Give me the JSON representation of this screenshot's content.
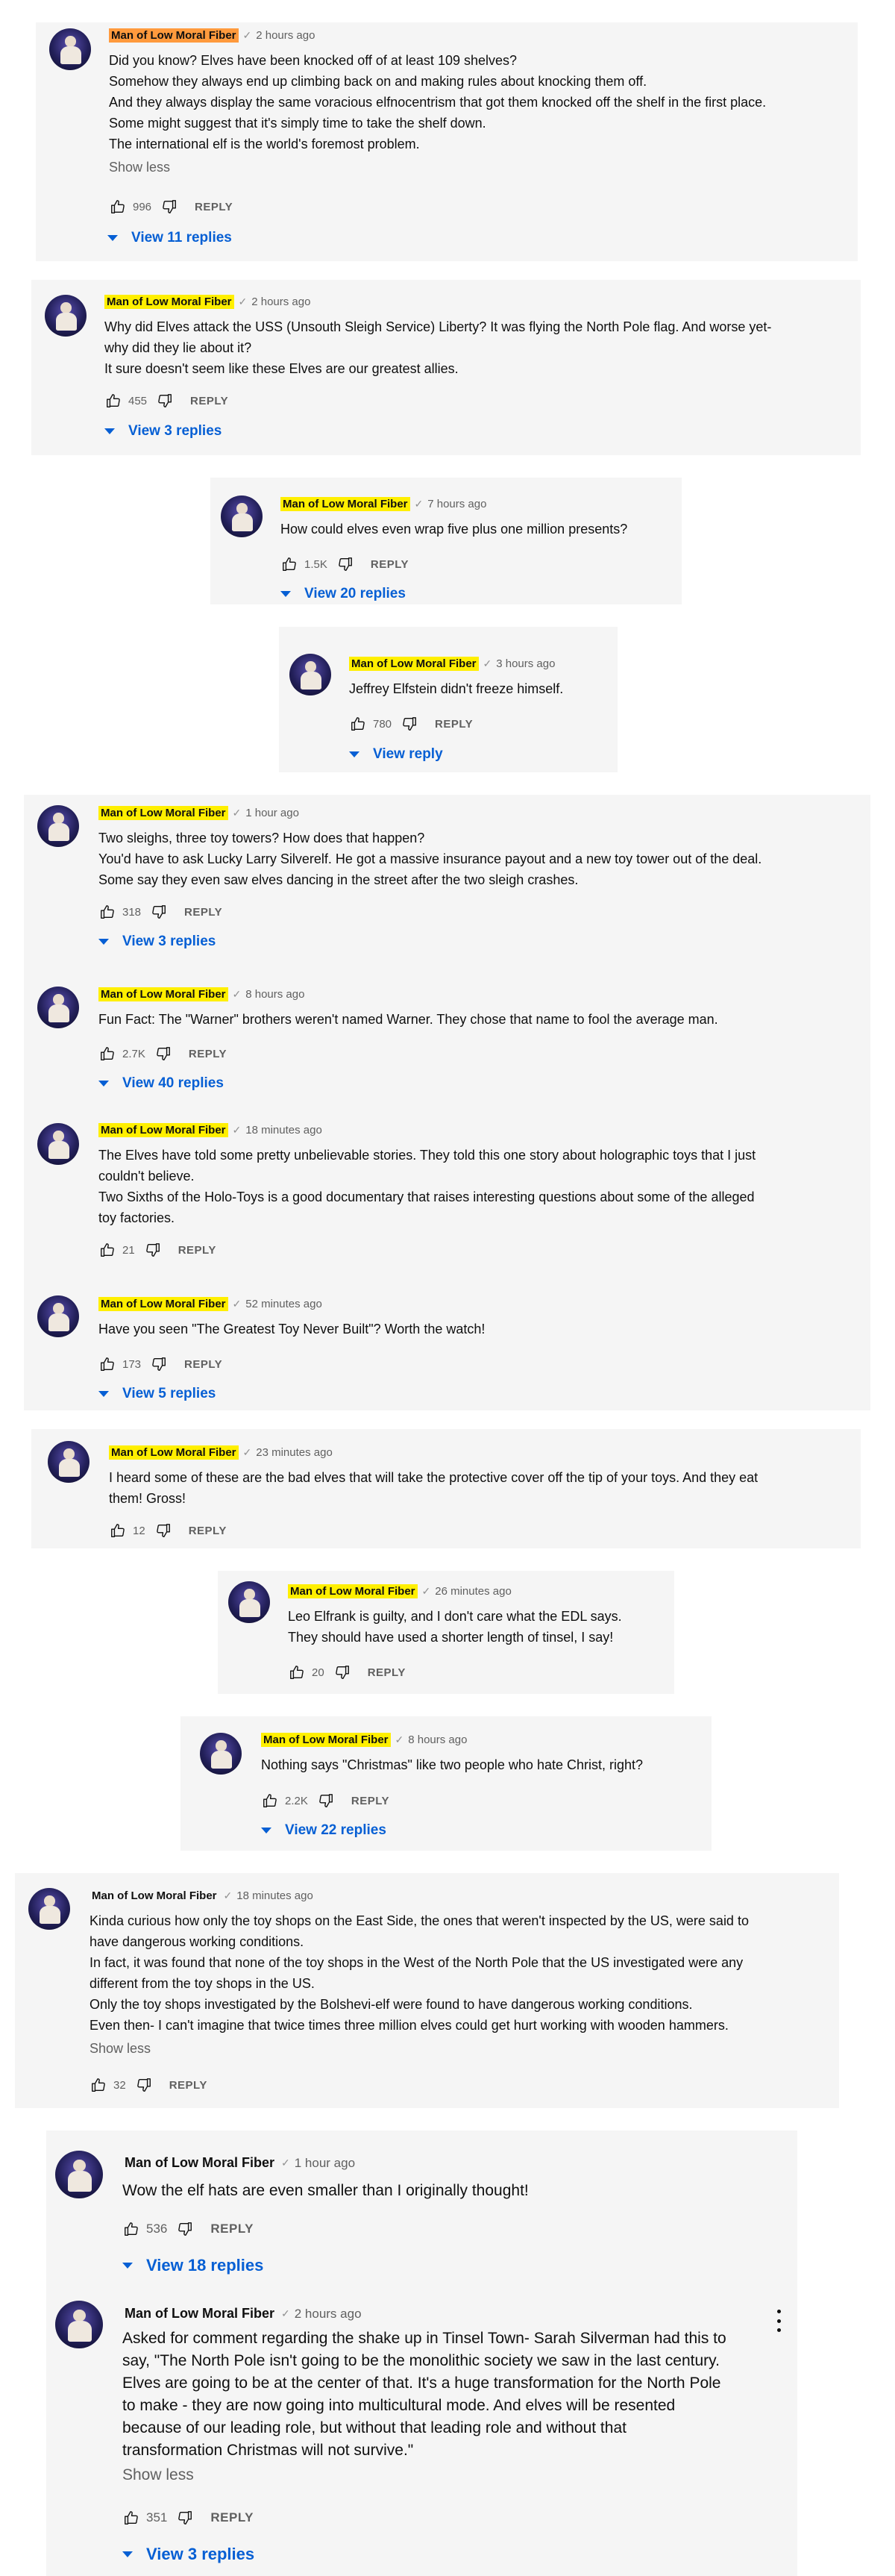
{
  "comments": [
    {
      "author": "Man of Low Moral Fiber",
      "verified": "✓",
      "time": "2 hours ago",
      "lines": [
        "Did you know? Elves have been knocked off of at least 109 shelves?",
        "Somehow they always end up climbing back on and making rules about knocking them off.",
        "And they always display the same voracious elfnocentrism that got them knocked off the shelf in the first place.",
        "Some might suggest that it's simply time to take the shelf down.",
        "The international elf is the world's foremost problem."
      ],
      "show_less": "Show less",
      "likes": "996",
      "reply": "REPLY",
      "view_replies": "View 11 replies"
    },
    {
      "author": "Man of Low Moral Fiber",
      "verified": "✓",
      "time": "2 hours ago",
      "lines": [
        "Why did Elves attack the USS (Unsouth Sleigh Service) Liberty? It was flying the North Pole flag. And worse yet-",
        "why did they lie about it?",
        "It sure doesn't seem like these Elves are our greatest allies."
      ],
      "likes": "455",
      "reply": "REPLY",
      "view_replies": "View 3 replies"
    },
    {
      "author": "Man of Low Moral Fiber",
      "verified": "✓",
      "time": "7 hours ago",
      "lines": [
        "How could elves even wrap five plus one million presents?"
      ],
      "likes": "1.5K",
      "reply": "REPLY",
      "view_replies": "View 20 replies"
    },
    {
      "author": "Man of Low Moral Fiber",
      "verified": "✓",
      "time": "3 hours ago",
      "lines": [
        "Jeffrey Elfstein didn't freeze himself."
      ],
      "likes": "780",
      "reply": "REPLY",
      "view_replies": "View reply"
    },
    {
      "author": "Man of Low Moral Fiber",
      "verified": "✓",
      "time": "1 hour ago",
      "lines": [
        "Two sleighs, three toy towers? How does that happen?",
        "You'd have to ask Lucky Larry Silverelf. He got a massive insurance payout and a new toy tower out of the deal.",
        "Some say they even saw elves dancing in the street after the two sleigh crashes."
      ],
      "likes": "318",
      "reply": "REPLY",
      "view_replies": "View 3 replies"
    },
    {
      "author": "Man of Low Moral Fiber",
      "verified": "✓",
      "time": "8 hours ago",
      "lines": [
        "Fun Fact: The \"Warner\" brothers weren't named Warner. They chose that name to fool the average man."
      ],
      "likes": "2.7K",
      "reply": "REPLY",
      "view_replies": "View 40 replies"
    },
    {
      "author": "Man of Low Moral Fiber",
      "verified": "✓",
      "time": "18 minutes ago",
      "lines": [
        "The Elves have told some pretty unbelievable stories. They told this one story about holographic toys that I just",
        "couldn't believe.",
        "Two Sixths of the Holo-Toys is a good documentary that raises interesting questions about some of the alleged",
        "toy factories."
      ],
      "likes": "21",
      "reply": "REPLY"
    },
    {
      "author": "Man of Low Moral Fiber",
      "verified": "✓",
      "time": "52 minutes ago",
      "lines": [
        "Have you seen \"The Greatest Toy Never Built\"? Worth the watch!"
      ],
      "likes": "173",
      "reply": "REPLY",
      "view_replies": "View 5 replies"
    },
    {
      "author": "Man of Low Moral Fiber",
      "verified": "✓",
      "time": "23 minutes ago",
      "lines": [
        "I heard some of these are the bad elves that will take the protective cover off the tip of your toys. And they eat",
        "them! Gross!"
      ],
      "likes": "12",
      "reply": "REPLY"
    },
    {
      "author": "Man of Low Moral Fiber",
      "verified": "✓",
      "time": "26 minutes ago",
      "lines": [
        "Leo Elfrank is guilty, and I don't care what the EDL says.",
        "They should have used a shorter length of tinsel, I say!"
      ],
      "likes": "20",
      "reply": "REPLY"
    },
    {
      "author": "Man of Low Moral Fiber",
      "verified": "✓",
      "time": "8 hours ago",
      "lines": [
        "Nothing says \"Christmas\" like two people who hate Christ, right?"
      ],
      "likes": "2.2K",
      "reply": "REPLY",
      "view_replies": "View 22 replies"
    },
    {
      "author": "Man of Low Moral Fiber",
      "verified": "✓",
      "time": "18 minutes ago",
      "lines": [
        "Kinda curious how only the toy shops on the East Side, the ones that weren't inspected by the US, were said to",
        "have dangerous working conditions.",
        "In fact, it was found that none of the toy shops in the West of the North Pole that the US investigated were any",
        "different from the toy shops in the US.",
        "Only the toy shops investigated by the Bolshevi-elf were found to have dangerous working conditions.",
        "Even then- I can't imagine that twice times three million elves could get hurt working with wooden hammers."
      ],
      "show_less": "Show less",
      "likes": "32",
      "reply": "REPLY"
    },
    {
      "author": "Man of Low Moral Fiber",
      "verified": "✓",
      "time": "1 hour ago",
      "lines": [
        "Wow the elf hats are even smaller than I originally thought!"
      ],
      "likes": "536",
      "reply": "REPLY",
      "view_replies": "View 18 replies"
    },
    {
      "author": "Man of Low Moral Fiber",
      "verified": "✓",
      "time": "2 hours ago",
      "lines": [
        "Asked for comment regarding the shake up in Tinsel Town- Sarah Silverman had this to",
        "say, \"The North Pole isn't going to be the monolithic society we saw in the last century.",
        "Elves are going to be at the center of that. It's a huge transformation for the North Pole",
        "to make - they are now going into multicultural mode. And elves will be resented",
        "because of our leading role, but without that leading role and without that",
        "transformation Christmas will not survive.\""
      ],
      "show_less": "Show less",
      "likes": "351",
      "reply": "REPLY",
      "view_replies": "View 3 replies"
    }
  ],
  "colors": {
    "highlight_yellow": "#ffef00",
    "highlight_orange": "#ff9a3d",
    "link_blue": "#065fd4",
    "card_bg": "#f5f5f5"
  },
  "icons": [
    "like-icon",
    "dislike-icon",
    "chevron-down-icon",
    "more-vert-icon",
    "verified-check-icon"
  ]
}
